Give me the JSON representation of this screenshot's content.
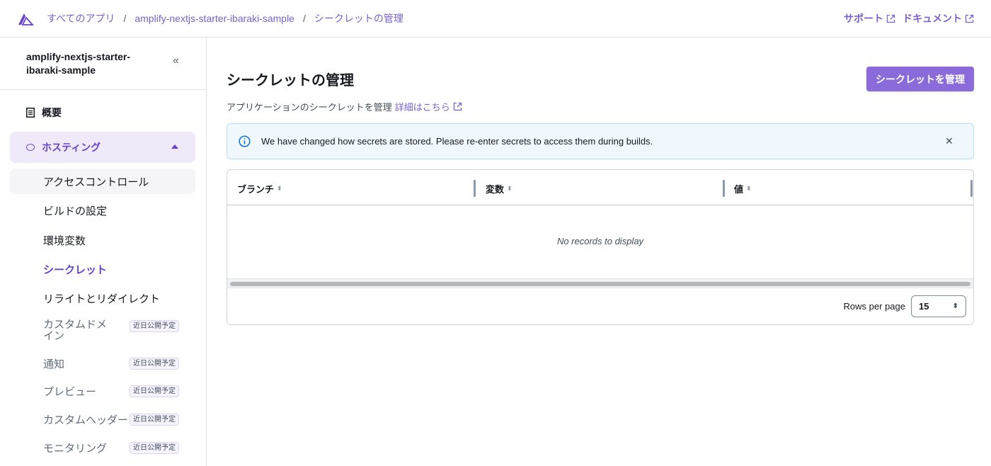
{
  "header": {
    "breadcrumbs": [
      "すべてのアプリ",
      "amplify-nextjs-starter-ibaraki-sample",
      "シークレットの管理"
    ],
    "separator": "/",
    "support_label": "サポート",
    "docs_label": "ドキュメント"
  },
  "sidebar": {
    "app_name": "amplify-nextjs-starter-ibaraki-sample",
    "collapse_glyph": "«",
    "overview_label": "概要",
    "hosting_label": "ホスティング",
    "items": [
      {
        "label": "アクセスコントロール"
      },
      {
        "label": "ビルドの設定"
      },
      {
        "label": "環境変数"
      },
      {
        "label": "シークレット"
      },
      {
        "label": "リライトとリダイレクト"
      },
      {
        "label": "カスタムドメイン",
        "badge": "近日公開予定"
      },
      {
        "label": "通知",
        "badge": "近日公開予定"
      },
      {
        "label": "プレビュー",
        "badge": "近日公開予定"
      },
      {
        "label": "カスタムヘッダー",
        "badge": "近日公開予定"
      },
      {
        "label": "モニタリング",
        "badge": "近日公開予定"
      }
    ]
  },
  "main": {
    "title": "シークレットの管理",
    "description": "アプリケーションのシークレットを管理",
    "learn_more": "詳細はこちら",
    "manage_button": "シークレットを管理",
    "alert_text": "We have changed how secrets are stored. Please re-enter secrets to access them during builds.",
    "table": {
      "columns": [
        "ブランチ",
        "変数",
        "値"
      ],
      "empty_text": "No records to display",
      "rows_per_page_label": "Rows per page",
      "rows_per_page_value": "15"
    }
  },
  "colors": {
    "accent": "#7b61c9",
    "accent_dark": "#6842c9",
    "button": "#8b6bd9",
    "alert_bg": "#f1f8fd"
  }
}
